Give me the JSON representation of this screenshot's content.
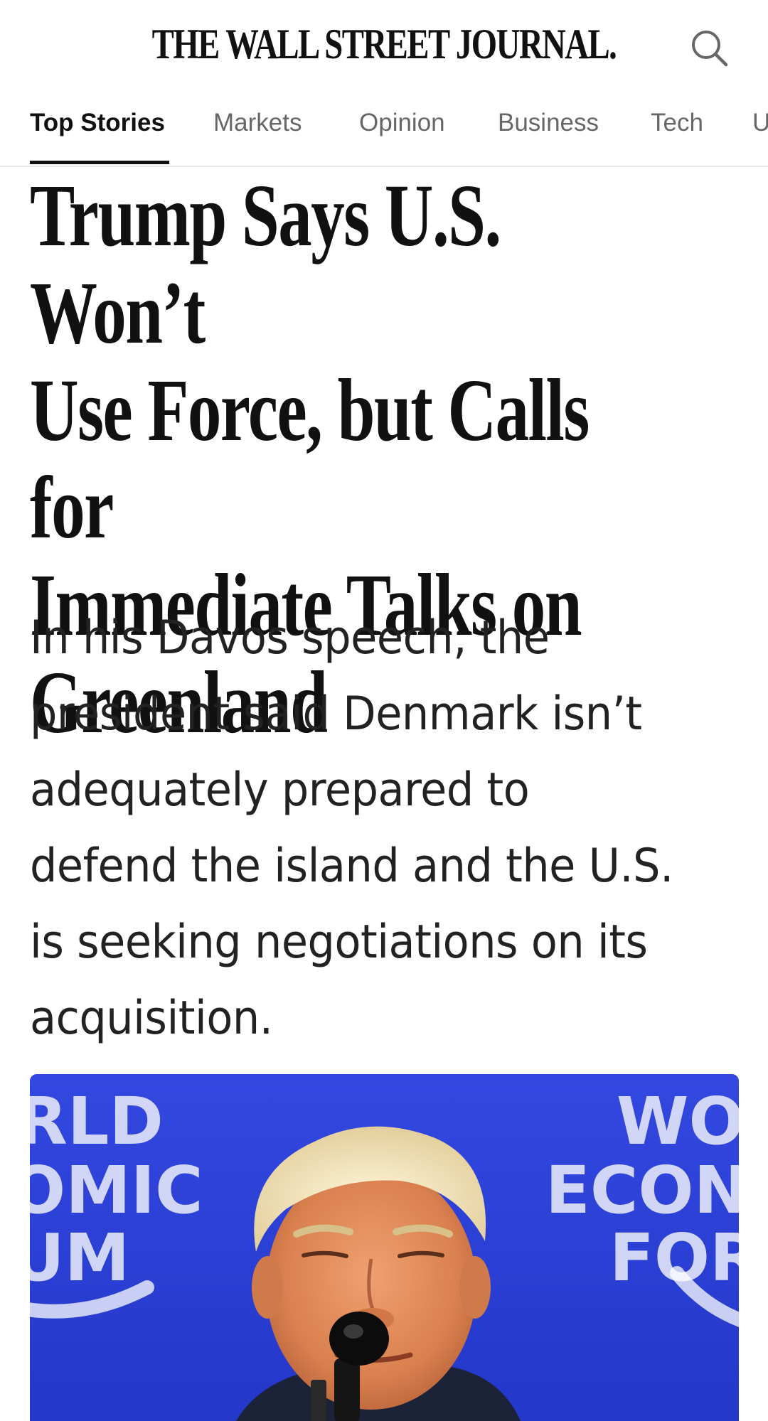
{
  "header": {
    "logo_text": "THE WALL STREET JOURNAL.",
    "search_icon": "search-icon"
  },
  "nav": {
    "tabs": [
      {
        "label": "Top Stories",
        "active": true
      },
      {
        "label": "Markets",
        "active": false
      },
      {
        "label": "Opinion",
        "active": false
      },
      {
        "label": "Business",
        "active": false
      },
      {
        "label": "Tech",
        "active": false
      },
      {
        "label": "U",
        "active": false
      }
    ]
  },
  "article": {
    "headline_lines": [
      "Trump Says U.S. Won’t",
      "Use Force, but Calls for",
      "Immediate Talks on",
      "Greenland"
    ],
    "dek_lines": [
      "In his Davos speech, the",
      "president said Denmark isn’t",
      "adequately prepared to",
      "defend the island and the U.S.",
      "is seeking negotiations on its",
      "acquisition."
    ],
    "image": {
      "backdrop_text_left": [
        "RLD",
        "OMIC",
        "UM"
      ],
      "backdrop_text_right": [
        "WO",
        "ECON",
        "FOR"
      ]
    }
  },
  "colors": {
    "text": "#111111",
    "tab_inactive": "#666666",
    "divider": "#e6e6e6",
    "image_background": "#2d40d8"
  }
}
